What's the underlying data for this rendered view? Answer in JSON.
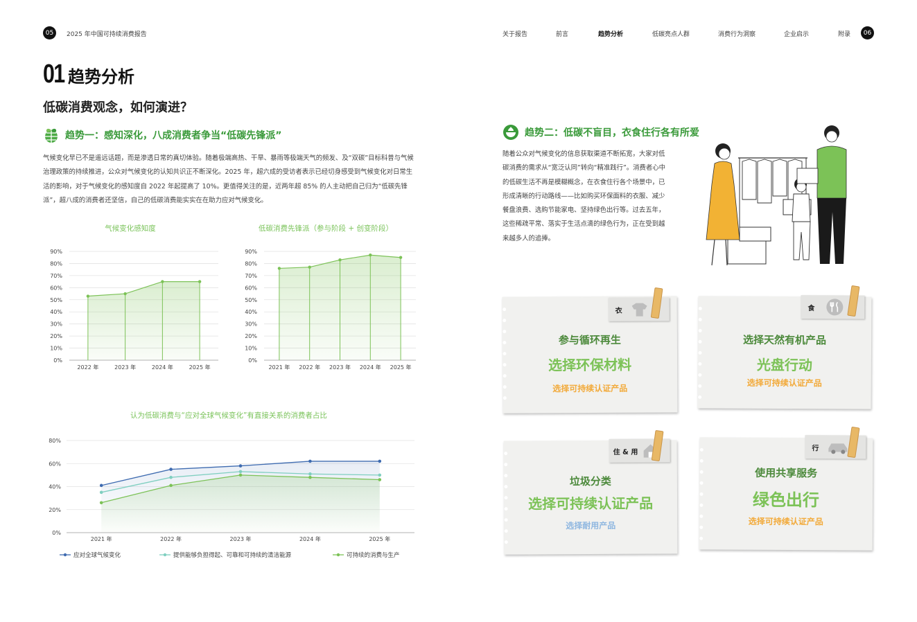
{
  "header": {
    "left_page_num": "05",
    "report_name": "2025 年中国可持续消费报告",
    "right_page_num": "06",
    "nav": [
      "关于报告",
      "前言",
      "趋势分析",
      "低碳亮点人群",
      "消费行为洞察",
      "企业启示",
      "附录"
    ],
    "nav_active": "趋势分析"
  },
  "section": {
    "number": "01",
    "title": "趋势分析",
    "question": "低碳消费观念，如何演进？"
  },
  "trend1": {
    "title": "趋势一：感知深化，八成消费者争当“低碳先锋派”",
    "body": "气候变化早已不是遥远话题，而是渗透日常的真切体验。随着极端高热、干旱、暴雨等极端天气的频发、及“双碳”目标科普与气候治理政策的持续推进，公众对气候变化的认知共识正不断深化。2025 年，超六成的受访者表示已经切身感受到气候变化对日常生活的影响，对于气候变化的感知度自 2022 年起提高了 10%。更值得关注的是，近两年超 85% 的人主动把自己归为“低碳先锋派”，超八成的消费者还坚信，自己的低碳消费能实实在在助力应对气候变化。"
  },
  "trend2": {
    "title": "趋势二：低碳不盲目，衣食住行各有所爱",
    "body": "随着公众对气候变化的信息获取渠道不断拓宽，大家对低碳消费的需求从“宽泛认同”转向“精准践行”。消费者心中的低碳生活不再是模糊概念，在衣食住行各个场景中，已形成清晰的行动路线——比如购买环保面料的衣服、减少餐盘浪费、选购节能家电、坚持绿色出行等。过去五年，这些稀疏平常、落实于生活点滴的绿色行为，正在受到越来越多人的追捧。"
  },
  "chart_data": [
    {
      "type": "area",
      "title": "气候变化感知度",
      "categories": [
        "2022 年",
        "2023 年",
        "2024 年",
        "2025 年"
      ],
      "values": [
        53,
        55,
        65,
        65
      ],
      "y_ticks": [
        "0%",
        "10%",
        "20%",
        "30%",
        "40%",
        "50%",
        "60%",
        "70%",
        "80%",
        "90%"
      ],
      "ylim": [
        0,
        90
      ],
      "grid": true,
      "colors": {
        "line": "#7cc257"
      }
    },
    {
      "type": "area",
      "title": "低碳消费先锋派（参与阶段 + 创变阶段）",
      "categories": [
        "2021 年",
        "2022 年",
        "2023 年",
        "2024 年",
        "2025 年"
      ],
      "values": [
        76,
        77,
        83,
        87,
        85
      ],
      "y_ticks": [
        "0%",
        "10%",
        "20%",
        "30%",
        "40%",
        "50%",
        "60%",
        "70%",
        "80%",
        "90%"
      ],
      "ylim": [
        0,
        90
      ],
      "grid": true,
      "colors": {
        "line": "#7cc257"
      }
    },
    {
      "type": "line",
      "title": "认为低碳消费与“应对全球气候变化”有直接关系的消费者占比",
      "categories": [
        "2021 年",
        "2022 年",
        "2023 年",
        "2024 年",
        "2025 年"
      ],
      "y_ticks": [
        "0%",
        "20%",
        "40%",
        "60%",
        "80%"
      ],
      "ylim": [
        0,
        80
      ],
      "grid": true,
      "legend": "bottom",
      "series": [
        {
          "name": "应对全球气候变化",
          "values": [
            41,
            55,
            58,
            62,
            62
          ],
          "color": "#3e6bb0"
        },
        {
          "name": "提供能够负担得起、可靠和可持续的清洁能源",
          "values": [
            35,
            48,
            53,
            51,
            50
          ],
          "color": "#7fcfc0"
        },
        {
          "name": "可持续的消费与生产",
          "values": [
            26,
            41,
            50,
            48,
            46
          ],
          "color": "#7cc257"
        }
      ]
    }
  ],
  "cards": [
    {
      "tag": "衣",
      "icon": "clothes-icon",
      "line1": "参与循环再生",
      "line2": "选择环保材料",
      "line3": "选择可持续认证产品"
    },
    {
      "tag": "食",
      "icon": "cutlery-icon",
      "line1": "选择天然有机产品",
      "line2": "光盘行动",
      "line3": "选择可持续认证产品"
    },
    {
      "tag": "住 & 用",
      "icon": "house-icon",
      "line1": "垃圾分类",
      "line2": "选择可持续认证产品",
      "line3": "选择耐用产品"
    },
    {
      "tag": "行",
      "icon": "car-icon",
      "line1": "使用共享服务",
      "line2": "绿色出行",
      "line3": "选择可持续认证产品"
    }
  ],
  "colors": {
    "green_title": "#3a9a3a",
    "green_light": "#7cc257",
    "orange": "#f2aa3a",
    "blue_light": "#8fb7e0",
    "navy": "#3e6bb0"
  }
}
